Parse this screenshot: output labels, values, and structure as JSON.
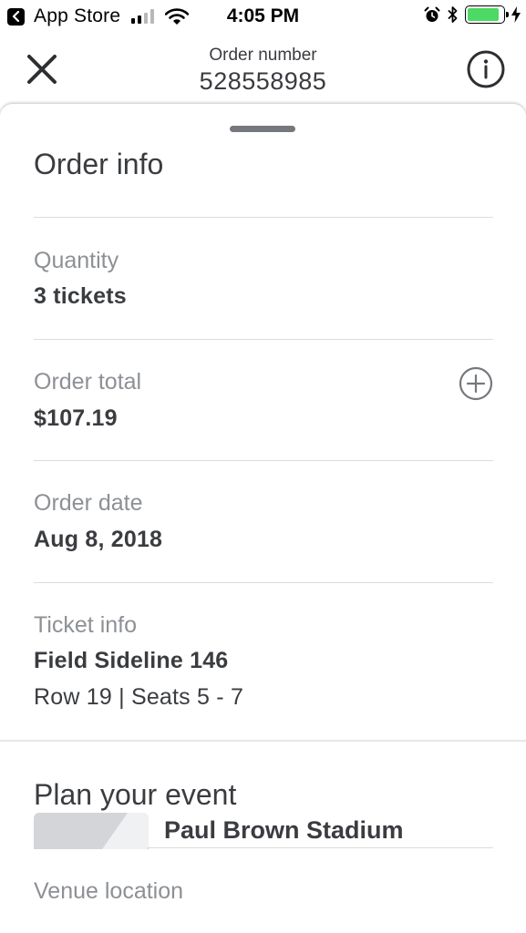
{
  "status_bar": {
    "back_app_label": "App Store",
    "time": "4:05 PM",
    "battery_level": 0.9,
    "battery_color": "#4cd964"
  },
  "header": {
    "order_number_label": "Order number",
    "order_number": "528558985",
    "close_icon": "close-icon",
    "info_icon": "info-icon"
  },
  "order_info": {
    "title": "Order info",
    "quantity": {
      "label": "Quantity",
      "value": "3 tickets"
    },
    "order_total": {
      "label": "Order total",
      "value": "$107.19",
      "expand_icon": "plus-circle-icon"
    },
    "order_date": {
      "label": "Order date",
      "value": "Aug 8, 2018"
    },
    "ticket_info": {
      "label": "Ticket info",
      "section": "Field Sideline 146",
      "seats": "Row 19 | Seats 5 - 7"
    }
  },
  "plan_event": {
    "title": "Plan your event",
    "venue_label": "Venue location",
    "venue_name": "Paul Brown Stadium"
  }
}
